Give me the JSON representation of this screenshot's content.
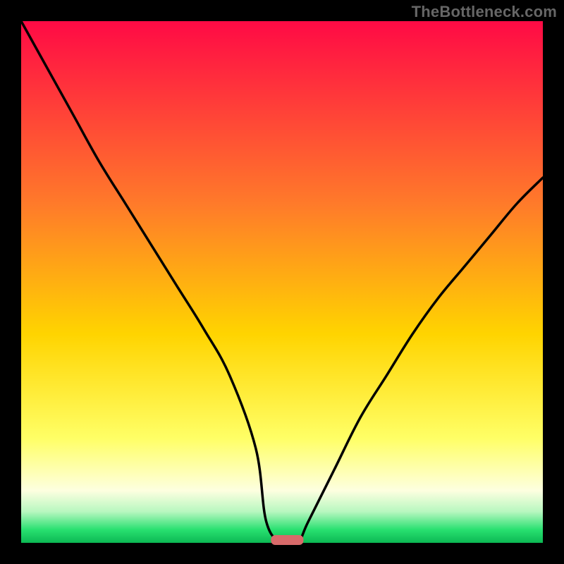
{
  "watermark": "TheBottleneck.com",
  "chart_data": {
    "type": "line",
    "title": "",
    "xlabel": "",
    "ylabel": "",
    "xlim": [
      0,
      100
    ],
    "ylim": [
      0,
      100
    ],
    "x": [
      0,
      5,
      10,
      15,
      20,
      25,
      30,
      35,
      40,
      45,
      47,
      50,
      53,
      55,
      60,
      65,
      70,
      75,
      80,
      85,
      90,
      95,
      100
    ],
    "values": [
      100,
      91,
      82,
      73,
      65,
      57,
      49,
      41,
      32,
      18,
      4,
      0,
      0,
      4,
      14,
      24,
      32,
      40,
      47,
      53,
      59,
      65,
      70
    ],
    "min_marker_x": 51,
    "gradient_stops": [
      {
        "pos": 0.0,
        "color": "#ff0a45"
      },
      {
        "pos": 0.35,
        "color": "#ff7a2a"
      },
      {
        "pos": 0.6,
        "color": "#ffd400"
      },
      {
        "pos": 0.8,
        "color": "#ffff66"
      },
      {
        "pos": 0.9,
        "color": "#fdffe0"
      },
      {
        "pos": 0.94,
        "color": "#b8f7c0"
      },
      {
        "pos": 0.975,
        "color": "#28e070"
      },
      {
        "pos": 1.0,
        "color": "#0cb853"
      }
    ],
    "marker_color": "#d86a6a"
  }
}
